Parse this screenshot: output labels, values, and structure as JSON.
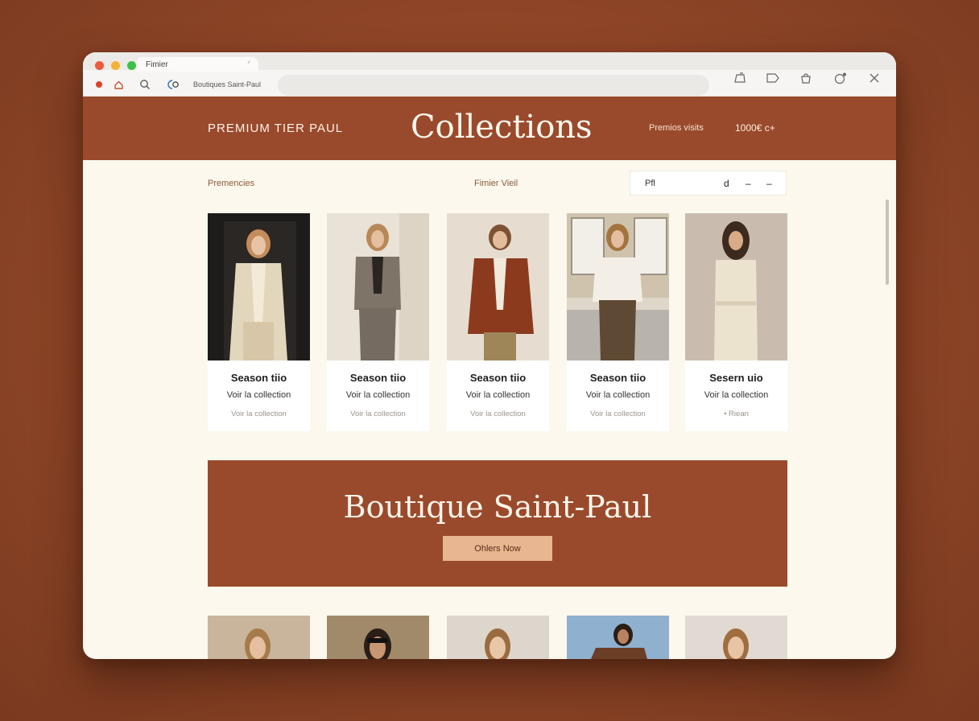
{
  "browser": {
    "tab_title": "Fimier",
    "url_text": "Boutiques  Saint-Paul",
    "traffic_lights": [
      "#ee5a3c",
      "#f2b234",
      "#3cc24a"
    ]
  },
  "header": {
    "brand": "PREMIUM TIER PAUL",
    "title": "Collections",
    "link": "Premios visits",
    "price": "1000€ c+"
  },
  "filters": {
    "left_label": "Premencies",
    "mid_label": "Fimier Vieil",
    "search_value": "Pfl",
    "controls": [
      "d",
      "–",
      "–"
    ]
  },
  "products": [
    {
      "title": "Season tiio",
      "link": "Voir la collection",
      "sub": "Voir la collection"
    },
    {
      "title": "Season tiio",
      "link": "Voir la collection",
      "sub": "Voir la collection"
    },
    {
      "title": "Season tiio",
      "link": "Voir la collection",
      "sub": "Voir la collection"
    },
    {
      "title": "Season tiio",
      "link": "Voir la collection",
      "sub": "Voir la collection"
    },
    {
      "title": "Sesern uio",
      "link": "Voir la collection",
      "sub": "• Riean"
    }
  ],
  "banner": {
    "title": "Boutique Saint-Paul",
    "button": "Ohlers Now"
  },
  "colors": {
    "brand_rust": "#9a4a2c",
    "page_cream": "#fcf8ed",
    "button_peach": "#e8b690"
  }
}
